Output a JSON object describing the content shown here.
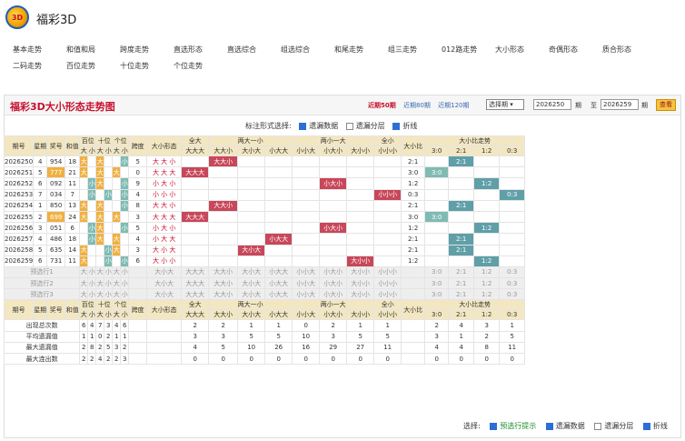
{
  "app": {
    "title": "福彩3D"
  },
  "nav": [
    "基本走势",
    "和值和局",
    "跨度走势",
    "直选形态",
    "直选综合",
    "组选综合",
    "和尾走势",
    "组三走势",
    "012路走势",
    "大小形态",
    "奇偶形态",
    "质合形态",
    "二码走势",
    "百位走势",
    "十位走势",
    "个位走势"
  ],
  "panel": {
    "title": "福彩3D大小形态走势图",
    "links": [
      "近期50期",
      "近期80期",
      "近期120期"
    ],
    "select": "选择期",
    "from": "2026250",
    "to": "2026259",
    "from_label": "期",
    "to_sep": "至",
    "to_label": "期",
    "query": "查看"
  },
  "options": {
    "label": "标注形式选择:",
    "items": [
      "遗漏数据",
      "遗漏分层",
      "折线"
    ]
  },
  "headers": {
    "issue": "期号",
    "week": "星期",
    "prize": "奖号",
    "sum": "和值",
    "bai": "百位",
    "shi": "十位",
    "ge": "个位",
    "da": "大",
    "xiao": "小",
    "kuadu": "跨度",
    "shape": "大小形态",
    "quanda": "全大",
    "liangda": "两大一小",
    "liangxiao": "两小一大",
    "quanxiao": "全小",
    "ratio": "大小比",
    "ratio_trend": "大小比走势",
    "sub_quanda": "大大大",
    "sub_liangda": [
      "大大小",
      "大小大",
      "小大大"
    ],
    "sub_liangxiao": [
      "小小大",
      "小大小",
      "大小小"
    ],
    "sub_quanxiao": "小小小",
    "sub_ratio": [
      "3:0",
      "2:1",
      "1:2",
      "0:3"
    ]
  },
  "rows": [
    {
      "issue": "2026250",
      "week": "4",
      "prize": "954",
      "sum": "18",
      "kuadu": "5",
      "shape": "大 大 小",
      "ratio": "2:1"
    },
    {
      "issue": "2026251",
      "week": "5",
      "prize": "777",
      "sum": "21",
      "kuadu": "0",
      "shape": "大 大 大",
      "ratio": "3:0"
    },
    {
      "issue": "2026252",
      "week": "6",
      "prize": "092",
      "sum": "11",
      "kuadu": "9",
      "shape": "小 大 小",
      "ratio": "1:2"
    },
    {
      "issue": "2026253",
      "week": "7",
      "prize": "034",
      "sum": "7",
      "kuadu": "4",
      "shape": "小 小 小",
      "ratio": "0:3"
    },
    {
      "issue": "2026254",
      "week": "1",
      "prize": "850",
      "sum": "13",
      "kuadu": "8",
      "shape": "大 大 小",
      "ratio": "2:1"
    },
    {
      "issue": "2026255",
      "week": "2",
      "prize": "699",
      "sum": "24",
      "kuadu": "3",
      "shape": "大 大 大",
      "ratio": "3:0"
    },
    {
      "issue": "2026256",
      "week": "3",
      "prize": "051",
      "sum": "6",
      "kuadu": "5",
      "shape": "小 大 小",
      "ratio": "1:2"
    },
    {
      "issue": "2026257",
      "week": "4",
      "prize": "486",
      "sum": "18",
      "kuadu": "4",
      "shape": "小 大 大",
      "ratio": "2:1"
    },
    {
      "issue": "2026258",
      "week": "5",
      "prize": "635",
      "sum": "14",
      "kuadu": "3",
      "shape": "大 小 大",
      "ratio": "2:1"
    },
    {
      "issue": "2026259",
      "week": "6",
      "prize": "731",
      "sum": "11",
      "kuadu": "6",
      "shape": "大 小 小",
      "ratio": "1:2"
    }
  ],
  "preview": [
    "预选行1",
    "预选行2",
    "预选行3"
  ],
  "stats": [
    {
      "label": "出现总次数",
      "vals": [
        "6",
        "4",
        "7",
        "3",
        "4",
        "6",
        "",
        "",
        "2",
        "2",
        "1",
        "1",
        "0",
        "2",
        "1",
        "1",
        "",
        "2",
        "4",
        "3",
        "1"
      ]
    },
    {
      "label": "平均遗漏值",
      "vals": [
        "1",
        "1",
        "0",
        "2",
        "1",
        "1",
        "",
        "",
        "3",
        "3",
        "5",
        "5",
        "10",
        "3",
        "5",
        "5",
        "",
        "3",
        "1",
        "2",
        "5"
      ]
    },
    {
      "label": "最大遗漏值",
      "vals": [
        "2",
        "8",
        "2",
        "5",
        "3",
        "2",
        "",
        "",
        "4",
        "5",
        "10",
        "26",
        "16",
        "29",
        "27",
        "11",
        "",
        "4",
        "4",
        "8",
        "11"
      ]
    },
    {
      "label": "最大连出数",
      "vals": [
        "2",
        "2",
        "4",
        "2",
        "2",
        "3",
        "",
        "",
        "0",
        "0",
        "0",
        "0",
        "0",
        "0",
        "0",
        "0",
        "",
        "0",
        "0",
        "0",
        "0"
      ]
    }
  ],
  "footer": {
    "label": "选择:",
    "items": [
      "预选行提示",
      "遗漏数据",
      "遗漏分层",
      "折线"
    ]
  }
}
